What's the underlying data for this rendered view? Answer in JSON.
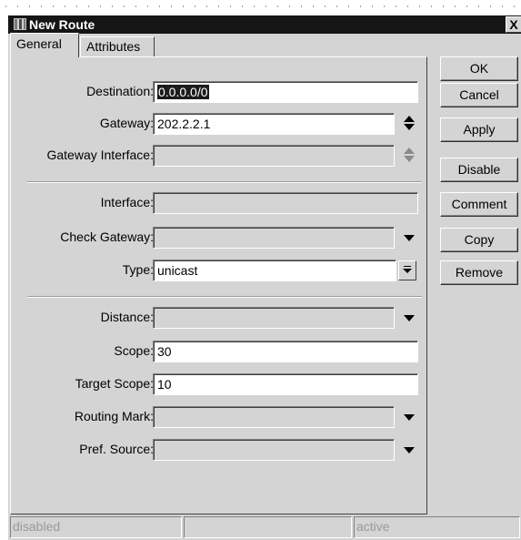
{
  "window": {
    "title": "New Route",
    "close_glyph": "X",
    "app_icon": "winbox-icon"
  },
  "tabs": [
    {
      "label": "General",
      "active": true
    },
    {
      "label": "Attributes",
      "active": false
    }
  ],
  "fields": {
    "destination": {
      "label": "Destination:",
      "value": "0.0.0.0/0"
    },
    "gateway": {
      "label": "Gateway:",
      "value": "202.2.2.1"
    },
    "gateway_interface": {
      "label": "Gateway Interface:",
      "value": ""
    },
    "interface": {
      "label": "Interface:",
      "value": ""
    },
    "check_gateway": {
      "label": "Check Gateway:",
      "value": ""
    },
    "type": {
      "label": "Type:",
      "value": "unicast"
    },
    "distance": {
      "label": "Distance:",
      "value": ""
    },
    "scope": {
      "label": "Scope:",
      "value": "30"
    },
    "target_scope": {
      "label": "Target Scope:",
      "value": "10"
    },
    "routing_mark": {
      "label": "Routing Mark:",
      "value": ""
    },
    "pref_source": {
      "label": "Pref. Source:",
      "value": ""
    }
  },
  "buttons": {
    "ok": "OK",
    "cancel": "Cancel",
    "apply": "Apply",
    "disable": "Disable",
    "comment": "Comment",
    "copy": "Copy",
    "remove": "Remove"
  },
  "status": {
    "left": "disabled",
    "middle": "",
    "right": "active"
  }
}
